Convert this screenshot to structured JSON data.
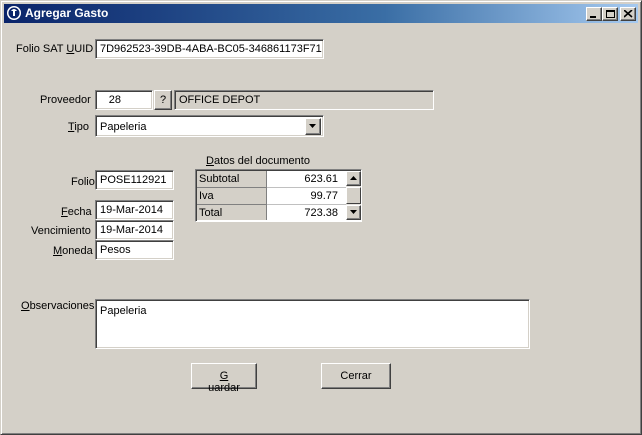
{
  "window": {
    "title": "Agregar Gasto",
    "minimize_label": "_",
    "maximize_label": "□",
    "close_label": "×"
  },
  "folio_sat": {
    "label_pre": "Folio SAT ",
    "label_u": "U",
    "label_post": "UID",
    "value": "7D962523-39DB-4ABA-BC05-346861173F71"
  },
  "proveedor": {
    "label": "Proveedor",
    "id": "28",
    "lookup_label": "?",
    "name": "OFFICE DEPOT"
  },
  "tipo": {
    "label_u": "T",
    "label_post": "ipo",
    "value": "Papeleria"
  },
  "folio": {
    "label": "Folio",
    "value": "POSE112921"
  },
  "fecha": {
    "label_u": "F",
    "label_post": "echa",
    "value": "19-Mar-2014"
  },
  "vencimiento": {
    "label": "Vencimiento",
    "value": "19-Mar-2014"
  },
  "moneda": {
    "label_u": "M",
    "label_post": "oneda",
    "value": "Pesos"
  },
  "documento": {
    "label_u": "D",
    "label_post": "atos del documento",
    "rows": [
      {
        "label": "Subtotal",
        "value": "623.61"
      },
      {
        "label": "Iva",
        "value": "99.77"
      },
      {
        "label": "Total",
        "value": "723.38"
      }
    ]
  },
  "observaciones": {
    "label_u": "O",
    "label_post": "bservaciones",
    "value": "Papeleria"
  },
  "buttons": {
    "guardar_u": "G",
    "guardar_post": "uardar",
    "cerrar": "Cerrar"
  },
  "icons": {
    "app": "app-logo-icon",
    "dropdown": "chevron-down-icon",
    "scroll_up": "arrow-up-icon",
    "scroll_down": "arrow-down-icon"
  },
  "colors": {
    "titlebar_start": "#0a246a",
    "titlebar_end": "#a6caf0",
    "face": "#d4d0c8"
  }
}
